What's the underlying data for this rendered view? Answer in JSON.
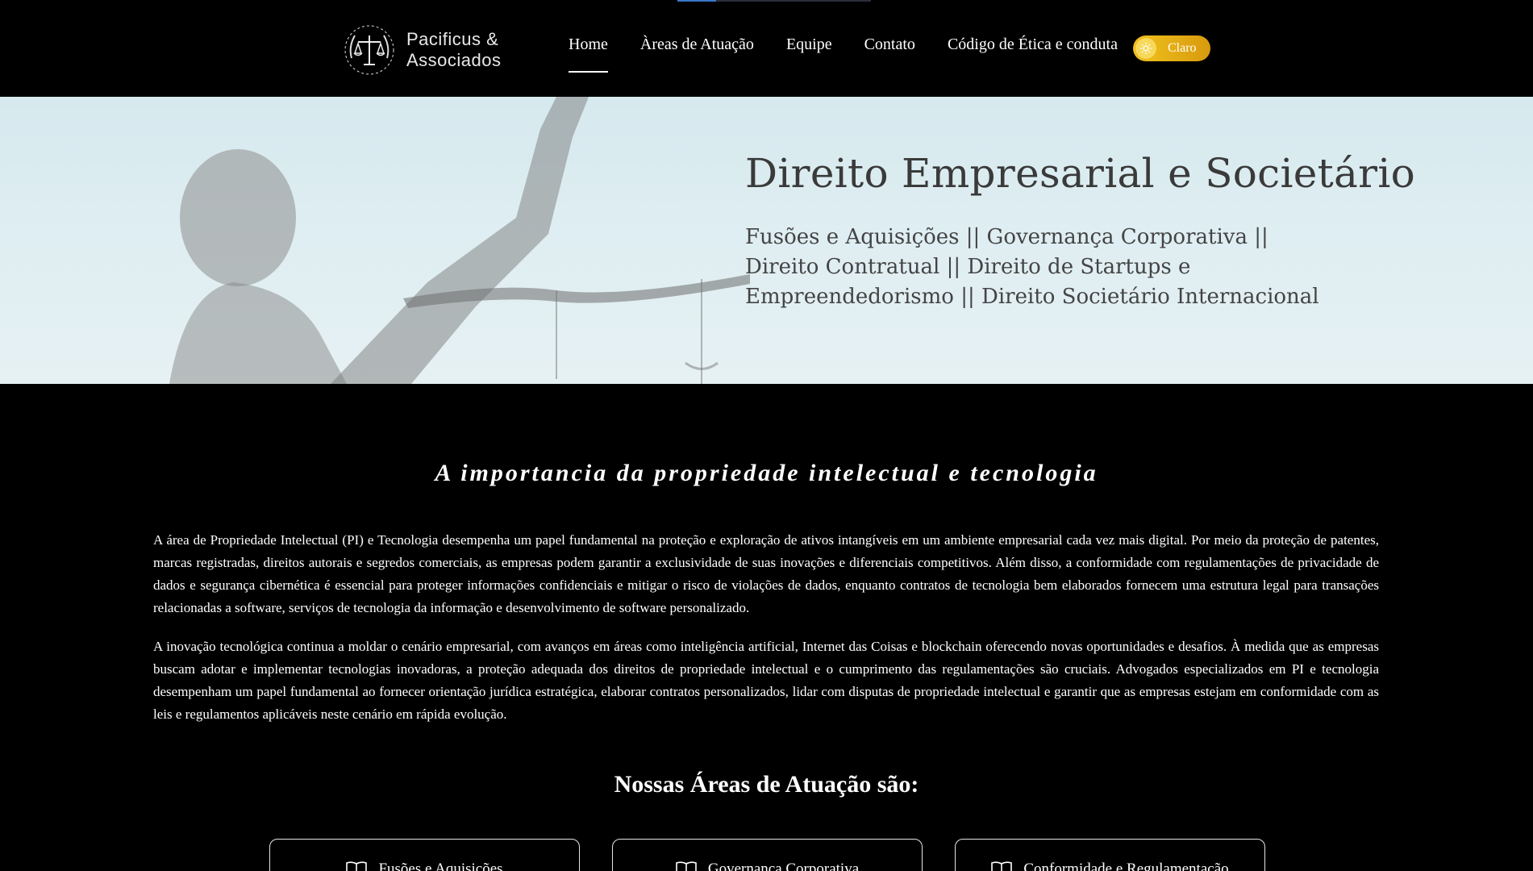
{
  "header": {
    "logo_line1": "Pacificus &",
    "logo_line2": "Associados",
    "nav": [
      {
        "label": "Home",
        "active": true
      },
      {
        "label": "Àreas de Atuação",
        "active": false
      },
      {
        "label": "Equipe",
        "active": false
      },
      {
        "label": "Contato",
        "active": false
      },
      {
        "label": "Código de Ética e conduta",
        "active": false
      }
    ],
    "theme_toggle_label": "Claro",
    "toggle_icon": "sun-icon"
  },
  "hero": {
    "title": "Direito Empresarial e Societário",
    "subtitle": "Fusões e Aquisições || Governança Corporativa || Direito Contratual || Direito de Startups e Empreendedorismo || Direito Societário Internacional"
  },
  "content": {
    "section_title": "A importancia da propriedade intelectual e tecnologia",
    "paragraph1": "A área de Propriedade Intelectual (PI) e Tecnologia desempenha um papel fundamental na proteção e exploração de ativos intangíveis em um ambiente empresarial cada vez mais digital. Por meio da proteção de patentes, marcas registradas, direitos autorais e segredos comerciais, as empresas podem garantir a exclusividade de suas inovações e diferenciais competitivos. Além disso, a conformidade com regulamentações de privacidade de dados e segurança cibernética é essencial para proteger informações confidenciais e mitigar o risco de violações de dados, enquanto contratos de tecnologia bem elaborados fornecem uma estrutura legal para transações relacionadas a software, serviços de tecnologia da informação e desenvolvimento de software personalizado.",
    "paragraph2": "A inovação tecnológica continua a moldar o cenário empresarial, com avanços em áreas como inteligência artificial, Internet das Coisas e blockchain oferecendo novas oportunidades e desafios. À medida que as empresas buscam adotar e implementar tecnologias inovadoras, a proteção adequada dos direitos de propriedade intelectual e o cumprimento das regulamentações são cruciais. Advogados especializados em PI e tecnologia desempenham um papel fundamental ao fornecer orientação jurídica estratégica, elaborar contratos personalizados, lidar com disputas de propriedade intelectual e garantir que as empresas estejam em conformidade com as leis e regulamentos aplicáveis neste cenário em rápida evolução.",
    "areas_heading": "Nossas Áreas de Atuação são:",
    "area_cards": [
      {
        "label": "Fusões e Aquisições",
        "icon": "book-icon"
      },
      {
        "label": "Governança Corporativa",
        "icon": "book-icon"
      },
      {
        "label": "Conformidade e Regulamentação",
        "icon": "book-icon"
      }
    ]
  },
  "colors": {
    "background": "#000000",
    "toggle_start": "#f0c31e",
    "toggle_end": "#d89a0e",
    "hero_bg": "#dcecf0"
  }
}
